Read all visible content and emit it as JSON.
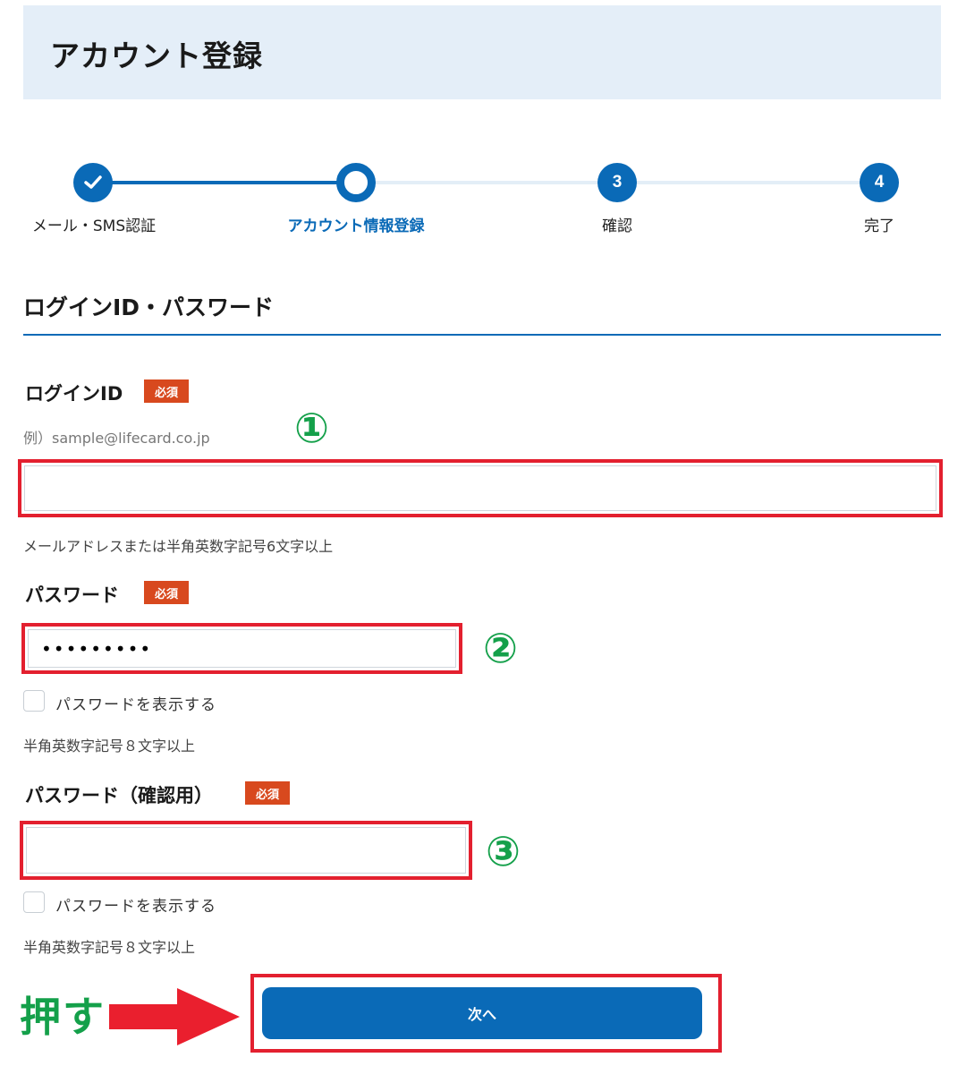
{
  "page": {
    "title": "アカウント登録"
  },
  "stepper": {
    "steps": [
      {
        "number": "",
        "label": "メール・SMS認証",
        "state": "done"
      },
      {
        "number": "",
        "label": "アカウント情報登録",
        "state": "current"
      },
      {
        "number": "3",
        "label": "確認",
        "state": "pending"
      },
      {
        "number": "4",
        "label": "完了",
        "state": "pending"
      }
    ],
    "accent": "#0a6ab7"
  },
  "section": {
    "title": "ログインID・パスワード"
  },
  "login_id": {
    "label": "ログインID",
    "required": "必須",
    "example": "例）sample@lifecard.co.jp",
    "value": "",
    "hint": "メールアドレスまたは半角英数字記号6文字以上"
  },
  "password": {
    "label": "パスワード",
    "required": "必須",
    "value": "•••••••••",
    "show_label": "パスワードを表示する",
    "hint": "半角英数字記号８文字以上"
  },
  "password_confirm": {
    "label": "パスワード（確認用）",
    "required": "必須",
    "value": "",
    "show_label": "パスワードを表示する",
    "hint": "半角英数字記号８文字以上"
  },
  "annotations": {
    "marker1": "①",
    "marker2": "②",
    "marker3": "③",
    "push": "押す",
    "highlight_color": "#e3202f",
    "marker_color": "#14a04a"
  },
  "next_button": {
    "label": "次へ"
  }
}
